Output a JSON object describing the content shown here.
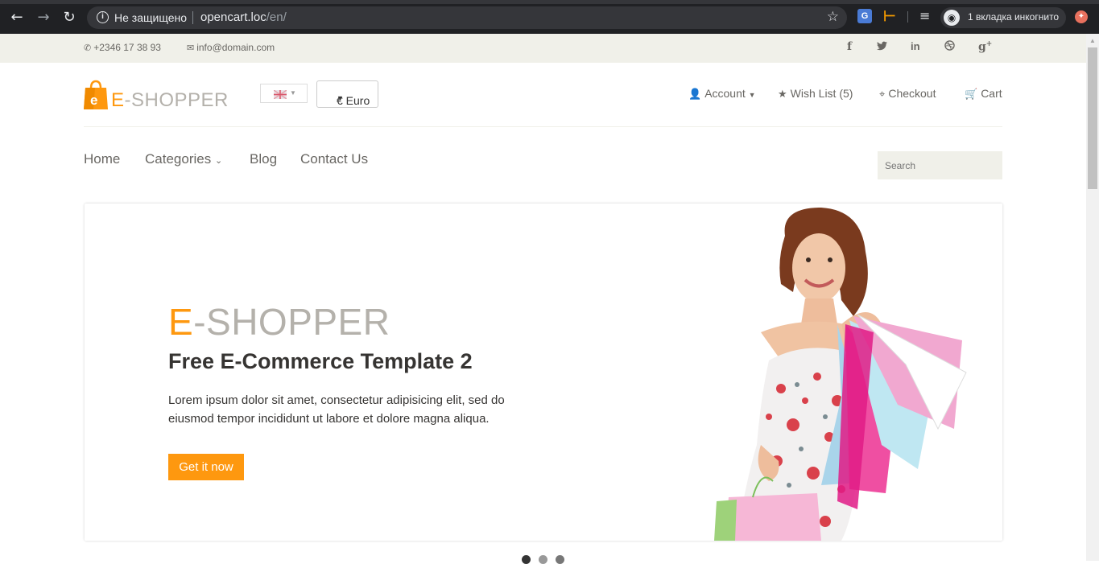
{
  "browser": {
    "security_label": "Не защищено",
    "url_host": "opencart.loc",
    "url_path": "/en/",
    "incognito_label": "1 вкладка инкогнито"
  },
  "topbar": {
    "phone": "+2346 17 38 93",
    "email": "info@domain.com",
    "social": [
      "f",
      "t",
      "in",
      "dribbble",
      "g+"
    ]
  },
  "header": {
    "logo_e": "E",
    "logo_rest": "-SHOPPER",
    "currency_label": "€ Euro",
    "menu": {
      "account": "Account",
      "wishlist": "Wish List (5)",
      "checkout": "Checkout",
      "cart": "Cart"
    }
  },
  "nav": {
    "items": [
      "Home",
      "Categories",
      "Blog",
      "Contact Us"
    ],
    "search_placeholder": "Search"
  },
  "slider": {
    "brand_e": "E",
    "brand_rest": "-SHOPPER",
    "title": "Free E-Commerce Template 2",
    "description": "Lorem ipsum dolor sit amet, consectetur adipisicing elit, sed do eiusmod tempor incididunt ut labore et dolore magna aliqua.",
    "button": "Get it now",
    "active_slide": 1,
    "slide_count": 3
  },
  "colors": {
    "accent": "#fe980f",
    "text_muted": "#696763",
    "text_dark": "#363432",
    "topbar_bg": "#f0f0e9"
  }
}
